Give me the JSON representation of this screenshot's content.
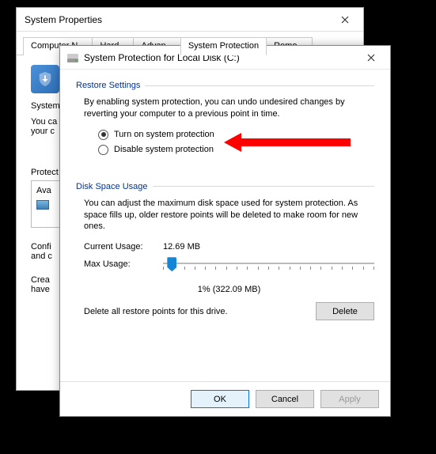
{
  "parent": {
    "title": "System Properties",
    "tabs": [
      "Computer N...",
      "Hard...",
      "Advan...",
      "System Protection",
      "Remo..."
    ],
    "heading": "System",
    "desc_l1": "You ca",
    "desc_l2": "your c",
    "section_protect": "Protect",
    "list_header": "Ava",
    "configure_l1": "Confi",
    "configure_l2": "and c",
    "create_l1": "Crea",
    "create_l2": "have"
  },
  "dialog": {
    "title": "System Protection for Local Disk (C:)",
    "restore_header": "Restore Settings",
    "restore_desc": "By enabling system protection, you can undo undesired changes by reverting your computer to a previous point in time.",
    "radio_on": "Turn on system protection",
    "radio_off": "Disable system protection",
    "disk_header": "Disk Space Usage",
    "disk_desc": "You can adjust the maximum disk space used for system protection. As space fills up, older restore points will be deleted to make room for new ones.",
    "current_label": "Current Usage:",
    "current_value": "12.69 MB",
    "max_label": "Max Usage:",
    "max_value": "1% (322.09 MB)",
    "delete_desc": "Delete all restore points for this drive.",
    "delete_btn": "Delete",
    "ok": "OK",
    "cancel": "Cancel",
    "apply": "Apply"
  },
  "slider": {
    "position_pct": 2
  }
}
